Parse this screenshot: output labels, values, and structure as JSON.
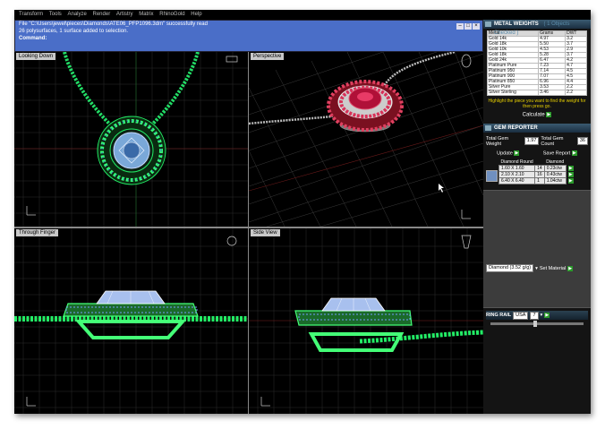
{
  "menu": [
    "Transform",
    "Tools",
    "Analyze",
    "Render",
    "Artistry",
    "Matrix",
    "RhinoGold",
    "Help"
  ],
  "command": {
    "file_line": "File \"C:\\Users\\jewel\\pieces\\Diamonds\\ATE06_PFP1096.3dm\" successfully read",
    "polysurface_line": "26 polysurfaces, 1 surface added to selection.",
    "prompt": "Command:"
  },
  "viewports": [
    {
      "label": "Looking Down"
    },
    {
      "label": "Perspective"
    },
    {
      "label": "Through Finger"
    },
    {
      "label": "Side View"
    }
  ],
  "metal_weights": {
    "title": "METAL WEIGHTS",
    "subtitle": "( 1 Objects Checked )",
    "headers": [
      "Metal",
      "Grams",
      "DWT"
    ],
    "rows": [
      [
        "Gold 14k",
        "4.97",
        "3.2"
      ],
      [
        "Gold 18k",
        "5.50",
        "3.7"
      ],
      [
        "Gold 10k",
        "4.53",
        "2.9"
      ],
      [
        "Gold 18k",
        "5.28",
        "3.7"
      ],
      [
        "Gold 24k",
        "6.47",
        "4.2"
      ],
      [
        "Platinum Pure",
        "7.23",
        "4.7"
      ],
      [
        "Platinum 950",
        "7.14",
        "4.5"
      ],
      [
        "Platinum 900",
        "7.07",
        "4.5"
      ],
      [
        "Platinum 850",
        "6.96",
        "4.4"
      ],
      [
        "Silver Pure",
        "3.53",
        "2.2"
      ],
      [
        "Silver Sterling",
        "3.46",
        "2.2"
      ]
    ],
    "note": "Highlight the piece you want to find the weight for then press go.",
    "calculate_label": "Calculate"
  },
  "gem_reporter": {
    "title": "GEM REPORTER",
    "total_weight_label": "Total Gem Weight",
    "total_weight_value": "1.97",
    "total_count_label": "Total Gem Count",
    "total_count_value": "36",
    "update_label": "Update",
    "save_label": "Save Report",
    "table_headers": [
      "Diamond Round",
      "",
      "Diamond"
    ],
    "table_rows": [
      [
        "1.60 X 1.60",
        "14",
        "0.23ctw"
      ],
      [
        "2.10 X 2.10",
        "16",
        "0.43ctw"
      ],
      [
        "6.40 X 6.40",
        "1",
        "1.04ctw"
      ]
    ]
  },
  "material": {
    "selected": "Diamond (3.52 g/g)",
    "set_label": "Set Material"
  },
  "ring_rail": {
    "title": "RING RAIL",
    "region": "USA",
    "size": "7"
  },
  "colors": {
    "accent": "#4a6ec8",
    "wire": "#00ee55",
    "ruby": "#d02050",
    "note_yellow": "#e8d000"
  }
}
